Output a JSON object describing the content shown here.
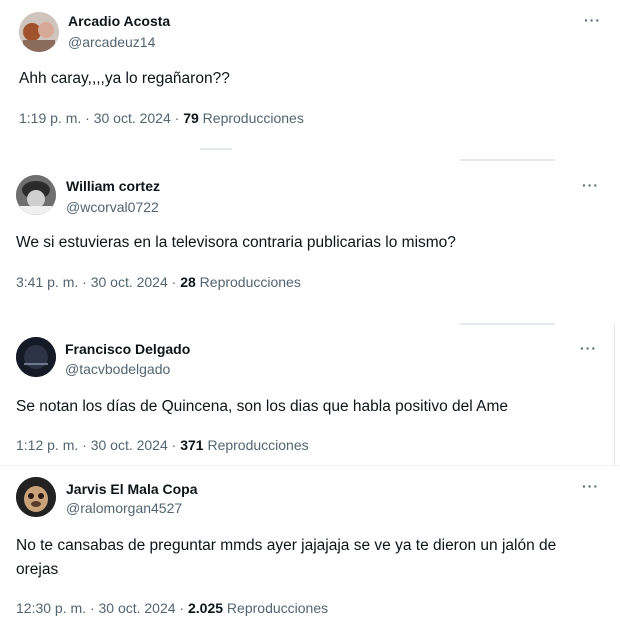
{
  "tweets": [
    {
      "name": "Arcadio Acosta",
      "handle": "@arcadeuz14",
      "text": "Ahh caray,,,,ya lo regañaron??",
      "time": "1:19 p. m. · 30 oct. 2024 · ",
      "views": "79",
      "views_label": " Reproducciones",
      "more": "···"
    },
    {
      "name": "William cortez",
      "handle": "@wcorval0722",
      "text": "We si estuvieras en la televisora contraria publicarias lo mismo?",
      "time": "3:41 p. m. · 30 oct. 2024 · ",
      "views": "28",
      "views_label": " Reproducciones",
      "more": "···"
    },
    {
      "name": "Francisco Delgado",
      "handle": "@tacvbodelgado",
      "text": "Se notan los días de Quincena, son los dias que habla positivo del Ame",
      "time": "1:12 p. m. · 30 oct. 2024 · ",
      "views": "371",
      "views_label": " Reproducciones",
      "more": "···"
    },
    {
      "name": "Jarvis El Mala Copa",
      "handle": "@ralomorgan4527",
      "text": "No te cansabas de preguntar mmds ayer jajajaja se ve ya te dieron un jalón de orejas",
      "time": "12:30 p. m. · 30 oct. 2024 · ",
      "views": "2.025",
      "views_label": " Reproducciones",
      "more": "···"
    }
  ]
}
